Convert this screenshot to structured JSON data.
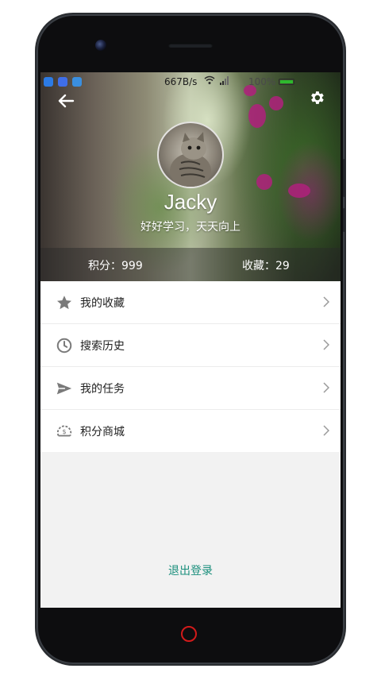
{
  "statusbar": {
    "net_speed": "667B/s",
    "battery_percent": "100%",
    "icons": [
      "shield-app-icon",
      "d-app-icon",
      "cloud-app-icon",
      "wifi-icon",
      "signal-icon",
      "battery-icon"
    ]
  },
  "profile": {
    "name": "Jacky",
    "motto": "好好学习，天天向上",
    "points": "积分：999",
    "favorites": "收藏：29"
  },
  "menu": {
    "items": [
      {
        "label": "我的收藏",
        "icon": "star-icon"
      },
      {
        "label": "搜索历史",
        "icon": "clock-icon"
      },
      {
        "label": "我的任务",
        "icon": "send-icon"
      },
      {
        "label": "积分商城",
        "icon": "points-shop-icon"
      }
    ]
  },
  "logout_label": "退出登录",
  "colors": {
    "accent": "#1a8f7c",
    "menu_icon": "#7a7a7a",
    "background": "#f2f2f2",
    "home_button_ring": "#d21a1a"
  }
}
